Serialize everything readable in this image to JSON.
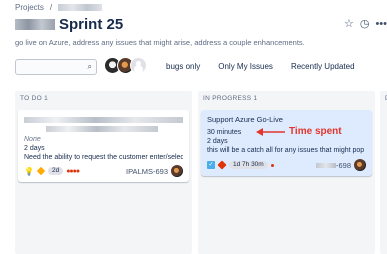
{
  "breadcrumb": {
    "projects": "Projects",
    "separator": "/"
  },
  "header": {
    "title": "Sprint 25",
    "description": "go live on Azure, address any issues that might arise, address a couple enhancements."
  },
  "toolbar": {
    "search_placeholder": "",
    "filters": [
      "bugs only",
      "Only My Issues",
      "Recently Updated"
    ]
  },
  "columns": [
    {
      "title": "TO DO 1",
      "card": {
        "parent_label": "None",
        "time_spent": "2 days",
        "description": "Need the ability to request the customer enter/select",
        "estimate": "2d",
        "key": "IPALMS-693"
      }
    },
    {
      "title": "IN PROGRESS 1",
      "card": {
        "summary": "Support Azure Go-Live",
        "time_spent": "30 minutes",
        "estimate_line": "2 days",
        "description": "this will be a catch all for any issues that might pop u",
        "remaining": "1d 7h 30m",
        "key_suffix": "-698"
      }
    }
  ],
  "annotation": {
    "text": "Time spent",
    "color": "#e3352a"
  },
  "colors": {
    "accent": "#0052cc",
    "selected_card": "#deebff",
    "column_bg": "#f4f5f7"
  }
}
